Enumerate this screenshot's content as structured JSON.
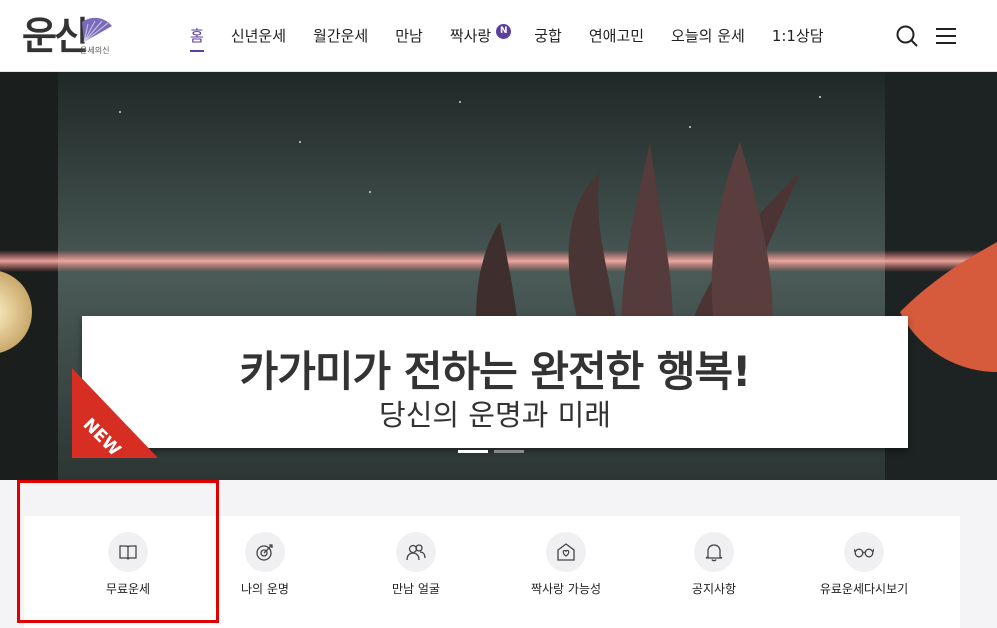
{
  "logo": {
    "text": "운신",
    "sub": "운세의신"
  },
  "nav": {
    "items": [
      {
        "label": "홈",
        "active": true
      },
      {
        "label": "신년운세"
      },
      {
        "label": "월간운세"
      },
      {
        "label": "만남"
      },
      {
        "label": "짝사랑",
        "badge": "N"
      },
      {
        "label": "궁합"
      },
      {
        "label": "연애고민"
      },
      {
        "label": "오늘의 운세"
      },
      {
        "label": "1:1상담"
      }
    ]
  },
  "header_icons": [
    "search-icon",
    "hamburger-menu-icon"
  ],
  "banner": {
    "title": "카가미가 전하는 완전한 행복!",
    "subtitle": "당신의 운명과 미래",
    "tag": "NEW",
    "slides": 2,
    "active_slide": 1
  },
  "quick_menu": [
    {
      "label": "무료운세",
      "icon": "book-icon"
    },
    {
      "label": "나의 운명",
      "icon": "target-icon"
    },
    {
      "label": "만남 얼굴",
      "icon": "people-icon"
    },
    {
      "label": "짝사랑 가능성",
      "icon": "heart-letter-icon"
    },
    {
      "label": "공지사항",
      "icon": "bell-icon"
    },
    {
      "label": "유료운세다시보기",
      "icon": "glasses-icon"
    }
  ],
  "colors": {
    "accent": "#5b3fa0",
    "highlight": "#e00000"
  }
}
